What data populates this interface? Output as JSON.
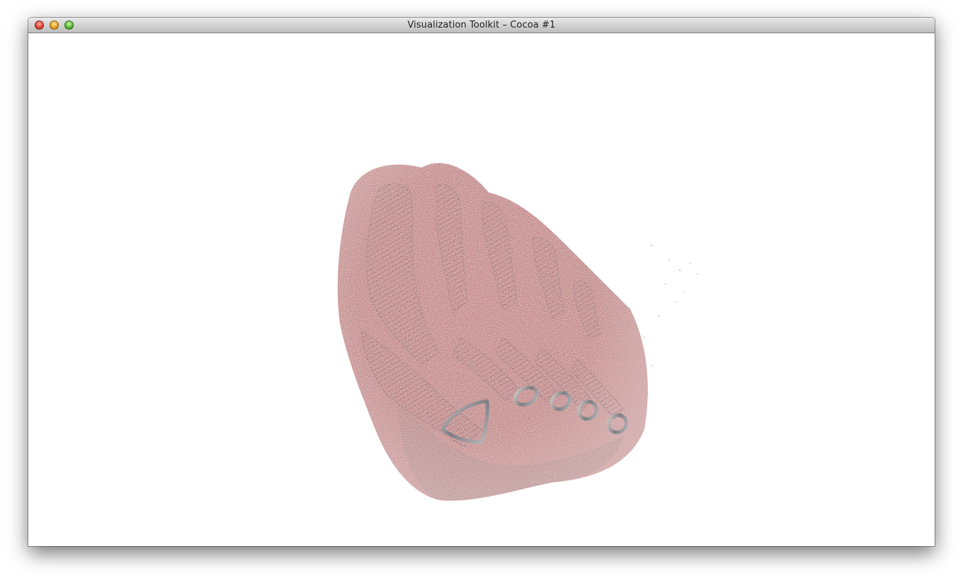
{
  "window": {
    "title": "Visualization Toolkit – Cocoa #1",
    "buttons": {
      "close": "close-button",
      "minimize": "minimize-button",
      "zoom": "zoom-button"
    }
  },
  "viewport": {
    "content": "volume-rendering-foot",
    "colors": {
      "tissue": "#a14848",
      "bone": "#8a8a8a",
      "background": "#ffffff"
    }
  }
}
